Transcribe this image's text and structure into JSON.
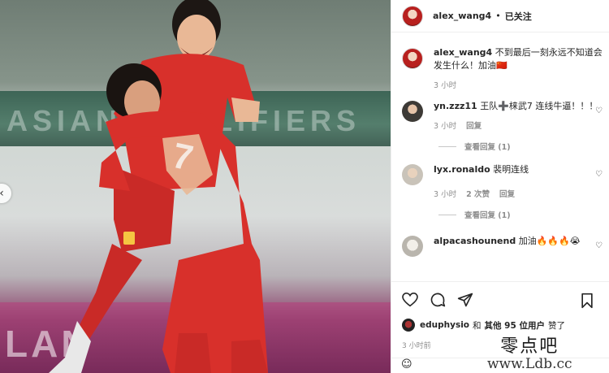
{
  "header": {
    "username": "alex_wang4",
    "separator": "•",
    "follow_status": "已关注"
  },
  "caption": {
    "username": "alex_wang4",
    "text": "不到最后一刻永远不知道会发生什么！加油🇨🇳",
    "time": "3 小时"
  },
  "comments": [
    {
      "username": "yn.zzz11",
      "text": "王队➕梾武7 连线牛逼！！！",
      "time": "3 小时",
      "reply_label": "回复",
      "likes": "",
      "view_replies": "查看回复 (1)"
    },
    {
      "username": "lyx.ronaldo",
      "text": "裴明连线",
      "time": "3 小时",
      "reply_label": "回复",
      "likes": "2 次赞",
      "view_replies": "查看回复 (1)"
    },
    {
      "username": "alpacashounend",
      "text": "加油🔥🔥🔥😭",
      "time": "",
      "reply_label": "",
      "likes": "",
      "view_replies": ""
    }
  ],
  "likes": {
    "liker": "eduphysio",
    "connector": "和",
    "others": "其他 95 位用户",
    "suffix": "赞了"
  },
  "post_time": "3 小时前",
  "add_comment_icon": "smiley-icon",
  "photo": {
    "banner_text": "ASIAN QUALIFIERS",
    "board_text": "LAN",
    "jersey_number": "7"
  },
  "watermark": {
    "site_name": "零点吧",
    "url": "www.Ldb.cc"
  },
  "colors": {
    "jersey_red": "#d8302b",
    "link_gray": "#8e8e8e"
  }
}
